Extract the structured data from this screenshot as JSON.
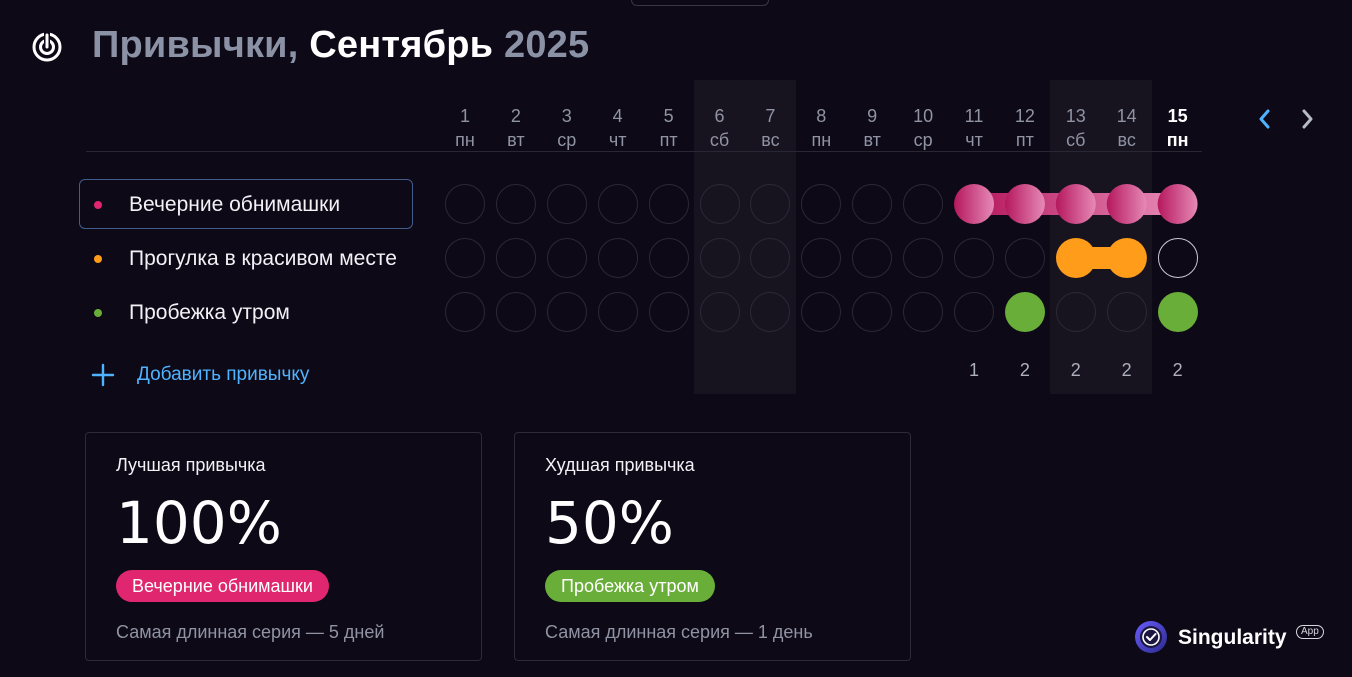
{
  "header": {
    "title_prefix": "Привычки,",
    "title_month": "Сентябрь",
    "title_year": "2025"
  },
  "days": [
    {
      "num": "1",
      "wd": "пн"
    },
    {
      "num": "2",
      "wd": "вт"
    },
    {
      "num": "3",
      "wd": "ср"
    },
    {
      "num": "4",
      "wd": "чт"
    },
    {
      "num": "5",
      "wd": "пт"
    },
    {
      "num": "6",
      "wd": "сб"
    },
    {
      "num": "7",
      "wd": "вс"
    },
    {
      "num": "8",
      "wd": "пн"
    },
    {
      "num": "9",
      "wd": "вт"
    },
    {
      "num": "10",
      "wd": "ср"
    },
    {
      "num": "11",
      "wd": "чт"
    },
    {
      "num": "12",
      "wd": "пт"
    },
    {
      "num": "13",
      "wd": "сб"
    },
    {
      "num": "14",
      "wd": "вс"
    },
    {
      "num": "15",
      "wd": "пн"
    }
  ],
  "habits": [
    {
      "name": "Вечерние обнимашки",
      "color": "#e0266f",
      "done_days": [
        11,
        12,
        13,
        14,
        15
      ]
    },
    {
      "name": "Прогулка в красивом месте",
      "color": "#ff9c1a",
      "done_days": [
        13,
        14
      ]
    },
    {
      "name": "Пробежка утром",
      "color": "#6aae3a",
      "done_days": [
        12,
        15
      ]
    }
  ],
  "add_habit_label": "Добавить привычку",
  "daily_counts": [
    {
      "day": 11,
      "value": "1"
    },
    {
      "day": 12,
      "value": "2"
    },
    {
      "day": 13,
      "value": "2"
    },
    {
      "day": 14,
      "value": "2"
    },
    {
      "day": 15,
      "value": "2"
    }
  ],
  "stats": {
    "best": {
      "title": "Лучшая привычка",
      "value": "100%",
      "habit": "Вечерние обнимашки",
      "badge_color": "#e0266f",
      "caption": "Самая длинная серия — 5 дней"
    },
    "worst": {
      "title": "Худшая привычка",
      "value": "50%",
      "habit": "Пробежка утром",
      "badge_color": "#6aae3a",
      "caption": "Самая длинная серия — 1 день"
    }
  },
  "brand": {
    "name": "Singularity",
    "tag": "App"
  },
  "colors": {
    "accent": "#4fb3ff",
    "background": "#0d0917"
  }
}
